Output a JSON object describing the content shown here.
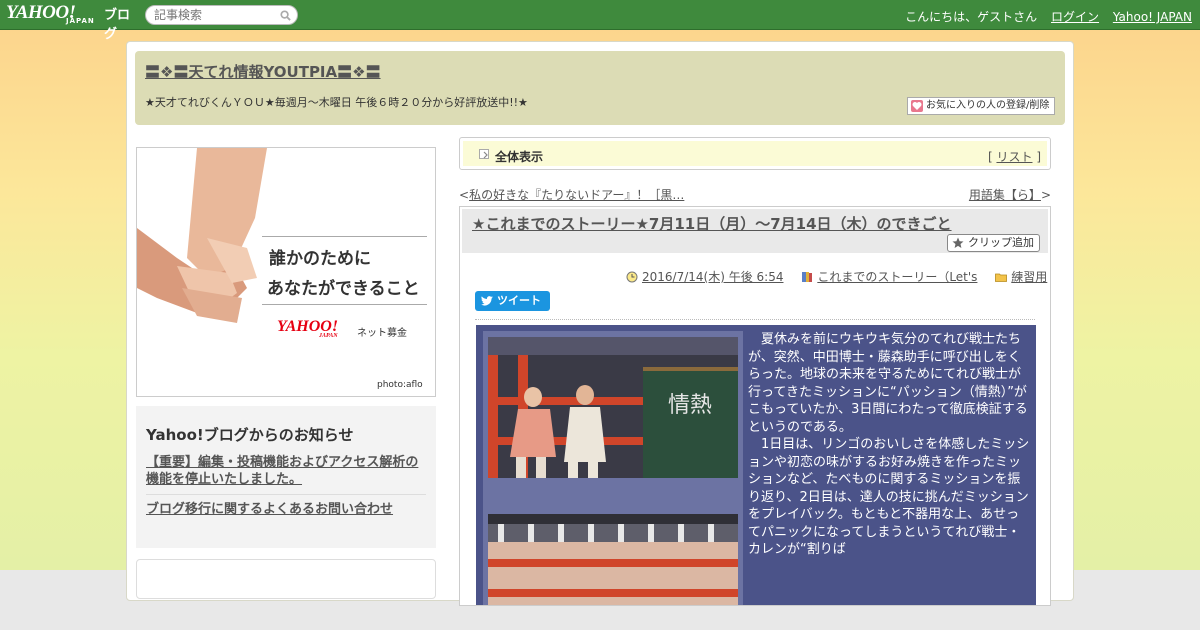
{
  "topbar": {
    "logo_text": "YAHOO!",
    "logo_sub": "JAPAN",
    "logo_blog": "ブログ",
    "search_placeholder": "記事検索",
    "greeting": "こんにちは、ゲストさん",
    "login": "ログイン",
    "yahoo_japan": "Yahoo! JAPAN"
  },
  "header": {
    "title": "〓❖〓天てれ情報YOUTPIA〓❖〓",
    "description": "★天才てれびくんＹＯＵ★毎週月～木曜日 午後６時２０分から好評放送中!!★",
    "fav_button": "お気に入りの人の登録/削除"
  },
  "sidebar": {
    "banner": {
      "line1": "誰かのために",
      "line2": "あなたができること",
      "logo": "YAHOO!",
      "logo_sub": "JAPAN",
      "logo_note": "ネット募金",
      "credit": "photo:aflo"
    },
    "notice": {
      "title": "Yahoo!ブログからのお知らせ",
      "items": [
        "【重要】編集・投稿機能およびアクセス解析の機能を停止いたしました。",
        "ブログ移行に関するよくあるお問い合わせ"
      ]
    }
  },
  "listbar": {
    "label": "全体表示",
    "bracket_open": "[",
    "link": "リスト",
    "bracket_close": "]"
  },
  "nav": {
    "prev_mark": "<",
    "prev": "私の好きな『たりないドアー』！［黒…",
    "next": "用語集【ら】",
    "next_mark": ">"
  },
  "article": {
    "title": "★これまでのストーリー★7月11日（月）～7月14日（木）のできごと",
    "clip_button": "クリップ追加",
    "date": "2016/7/14(木) 午後 6:54",
    "category": "これまでのストーリー（Let's",
    "folder": "練習用",
    "tweet": "ツイート",
    "body": "　夏休みを前にウキウキ気分のてれび戦士たちが、突然、中田博士・藤森助手に呼び出しをくらった。地球の未来を守るためにてれび戦士が行ってきたミッションに“パッション（情熱）”がこもっていたか、3日間にわたって徹底検証するというのである。\n　1日目は、リンゴのおいしさを体感したミッションや初恋の味がするお好み焼きを作ったミッションなど、たべものに関するミッションを振り返り、2日目は、達人の技に挑んだミッションをプレイバック。もともと不器用な上、あせってパニックになってしまうというてれび戦士・カレンが“割りば",
    "blackboard_text": "情熱"
  },
  "colors": {
    "topbar": "#3f8a3d",
    "header": "#dcdcb5",
    "content_box": "#4b5389",
    "photo_frame": "#6c73a3",
    "tweet": "#1b95e0"
  }
}
